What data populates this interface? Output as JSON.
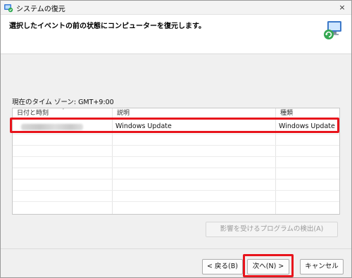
{
  "window": {
    "title": "システムの復元",
    "close_glyph": "×"
  },
  "header": {
    "instruction": "選択したイベントの前の状態にコンピューターを復元します。",
    "icon": "system-restore-icon"
  },
  "timezone_text": "現在のタイム ゾーン: GMT+9:00",
  "list": {
    "columns": [
      {
        "label": "日付と時刻"
      },
      {
        "label": "説明"
      },
      {
        "label": "種類"
      }
    ],
    "sort_glyph": "ˇ",
    "rows": [
      {
        "date": "",
        "description": "Windows Update",
        "type": "Windows Update",
        "selected": true
      }
    ]
  },
  "buttons": {
    "scan": "影響を受けるプログラムの検出(A)",
    "back": "< 戻る(B)",
    "next": "次へ(N) >",
    "cancel": "キャンセル"
  },
  "colors": {
    "highlight": "#e8141c",
    "window_bg": "#f0f0f0",
    "panel_bg": "#ffffff"
  }
}
